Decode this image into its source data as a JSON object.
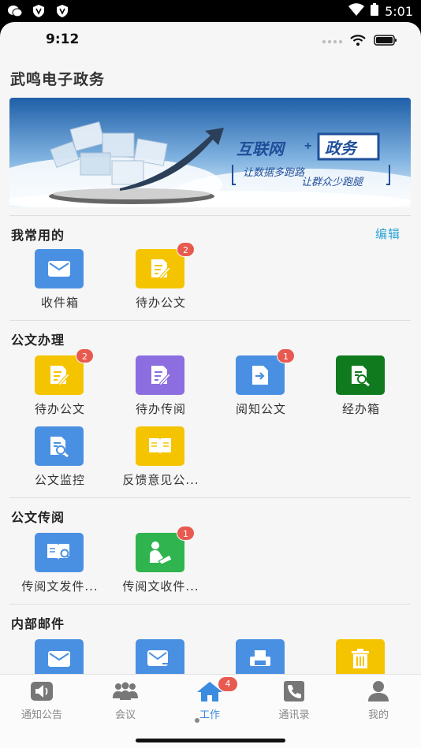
{
  "android_status": {
    "time": "5:01"
  },
  "ios_status": {
    "time": "9:12"
  },
  "app": {
    "title": "武鸣电子政务"
  },
  "banner": {
    "headline_part1": "互联网",
    "headline_plus": "+",
    "headline_part2": "政务",
    "slogan_line1": "让数据多跑路",
    "slogan_line2": "让群众少跑腿"
  },
  "favorites": {
    "title": "我常用的",
    "edit_label": "编辑",
    "items": [
      {
        "label": "收件箱",
        "icon": "mail-icon",
        "color": "#4a90e2",
        "badge": ""
      },
      {
        "label": "待办公文",
        "icon": "document-edit-icon",
        "color": "#f5c400",
        "badge": "2"
      }
    ]
  },
  "docs": {
    "title": "公文办理",
    "items": [
      {
        "label": "待办公文",
        "icon": "document-edit-icon",
        "color": "#f5c400",
        "badge": "2"
      },
      {
        "label": "待办传阅",
        "icon": "document-edit-icon",
        "color": "#8c6ee0",
        "badge": ""
      },
      {
        "label": "阅知公文",
        "icon": "document-forward-icon",
        "color": "#4a90e2",
        "badge": "1"
      },
      {
        "label": "经办箱",
        "icon": "document-search-icon",
        "color": "#0f7a1e",
        "badge": ""
      },
      {
        "label": "公文监控",
        "icon": "document-search-icon",
        "color": "#4a90e2",
        "badge": ""
      },
      {
        "label": "反馈意见公...",
        "icon": "open-book-icon",
        "color": "#f5c400",
        "badge": ""
      }
    ]
  },
  "circulation": {
    "title": "公文传阅",
    "items": [
      {
        "label": "传阅文发件...",
        "icon": "book-search-icon",
        "color": "#4a90e2",
        "badge": ""
      },
      {
        "label": "传阅文收件...",
        "icon": "person-reading-icon",
        "color": "#2fb44f",
        "badge": "1"
      }
    ]
  },
  "internal_mail": {
    "title": "内部邮件",
    "items": [
      {
        "label": "",
        "icon": "mail-icon",
        "color": "#4a90e2"
      },
      {
        "label": "",
        "icon": "mail-send-icon",
        "color": "#4a90e2"
      },
      {
        "label": "",
        "icon": "printer-icon",
        "color": "#4a90e2"
      },
      {
        "label": "",
        "icon": "trash-icon",
        "color": "#f5c400"
      }
    ]
  },
  "tabbar": {
    "tabs": [
      {
        "label": "通知公告",
        "icon": "speaker-icon",
        "active": false
      },
      {
        "label": "会议",
        "icon": "group-icon",
        "active": false
      },
      {
        "label": "工作",
        "icon": "home-icon",
        "active": true,
        "badge": "4"
      },
      {
        "label": "通讯录",
        "icon": "phone-book-icon",
        "active": false
      },
      {
        "label": "我的",
        "icon": "user-icon",
        "active": false
      }
    ]
  }
}
